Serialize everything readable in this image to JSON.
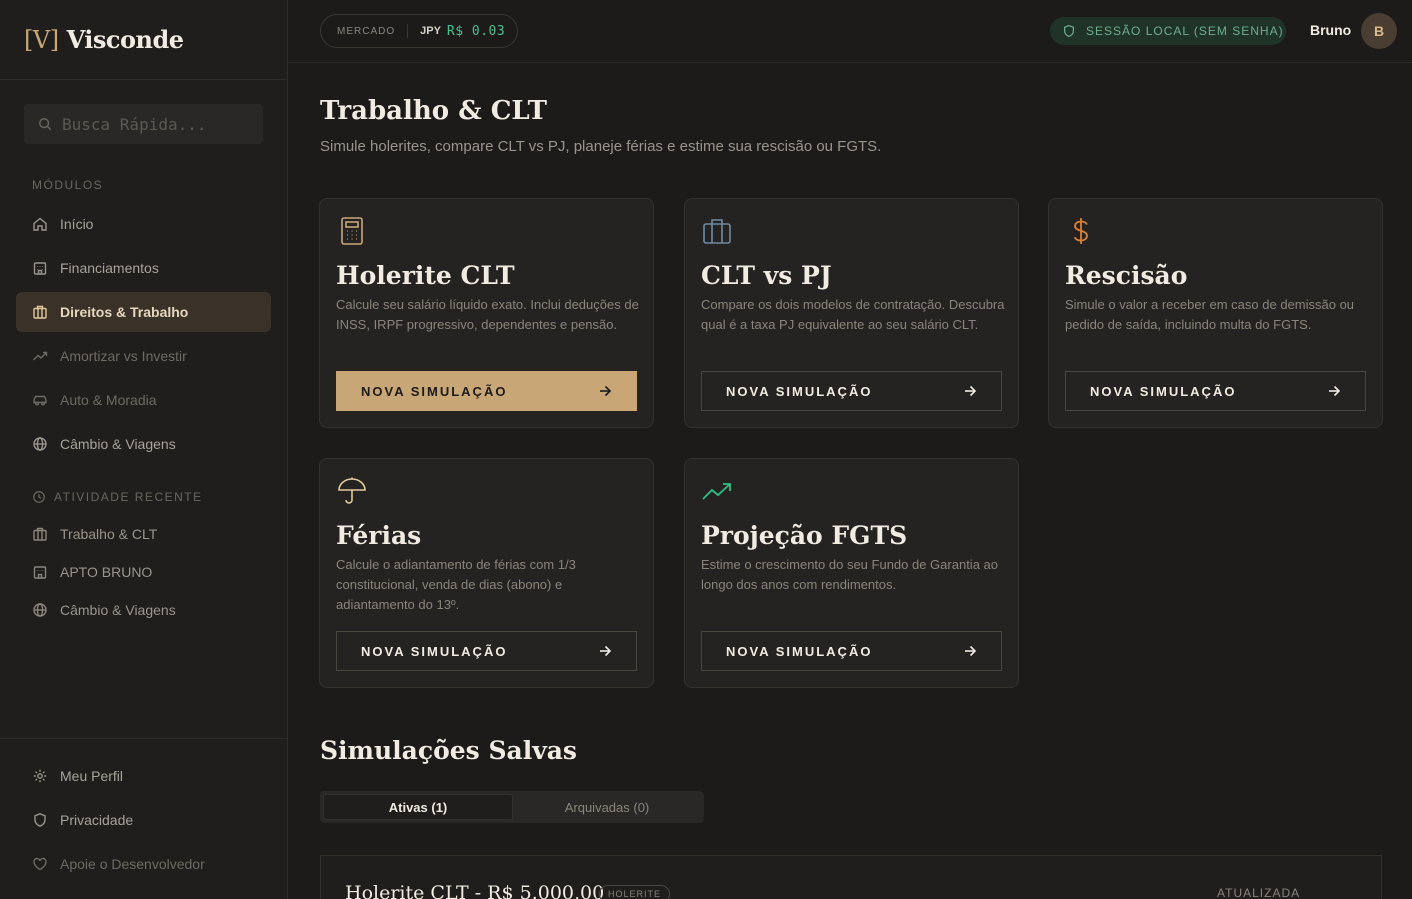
{
  "brand": {
    "bracket": "[V]",
    "name": "Visconde"
  },
  "search": {
    "placeholder": "Busca Rápida..."
  },
  "sidebar": {
    "modules_label": "MÓDULOS",
    "items": [
      {
        "label": "Início",
        "icon": "home-icon"
      },
      {
        "label": "Financiamentos",
        "icon": "building-icon"
      },
      {
        "label": "Direitos & Trabalho",
        "icon": "briefcase-icon",
        "active": true
      },
      {
        "label": "Amortizar vs Investir",
        "icon": "trend-icon"
      },
      {
        "label": "Auto & Moradia",
        "icon": "car-icon"
      },
      {
        "label": "Câmbio & Viagens",
        "icon": "globe-icon"
      }
    ],
    "recent_label": "ATIVIDADE RECENTE",
    "recent": [
      {
        "label": "Trabalho & CLT",
        "icon": "briefcase-icon"
      },
      {
        "label": "APTO BRUNO",
        "icon": "building-icon"
      },
      {
        "label": "Câmbio & Viagens",
        "icon": "globe-icon"
      }
    ],
    "bottom": [
      {
        "label": "Meu Perfil",
        "icon": "gear-icon"
      },
      {
        "label": "Privacidade",
        "icon": "shield-icon"
      },
      {
        "label": "Apoie o Desenvolvedor",
        "icon": "heart-icon"
      }
    ]
  },
  "topbar": {
    "market_label": "MERCADO",
    "currency": "JPY",
    "rate": "R$ 0.03",
    "session": "SESSÃO LOCAL (SEM SENHA)",
    "user": "Bruno",
    "avatar_initial": "B"
  },
  "main": {
    "title": "Trabalho & CLT",
    "subtitle": "Simule holerites, compare CLT vs PJ, planeje férias e estime sua rescisão ou FGTS.",
    "cards": [
      {
        "title": "Holerite CLT",
        "description": "Calcule seu salário líquido exato. Inclui deduções de INSS, IRPF progressivo, dependentes e pensão.",
        "button": "NOVA SIMULAÇÃO",
        "icon": "calculator-icon"
      },
      {
        "title": "CLT vs PJ",
        "description": "Compare os dois modelos de contratação. Descubra qual é a taxa PJ equivalente ao seu salário CLT.",
        "button": "NOVA SIMULAÇÃO",
        "icon": "briefcase-icon"
      },
      {
        "title": "Rescisão",
        "description": "Simule o valor a receber em caso de demissão ou pedido de saída, incluindo multa do FGTS.",
        "button": "NOVA SIMULAÇÃO",
        "icon": "dollar-icon"
      },
      {
        "title": "Férias",
        "description": "Calcule o adiantamento de férias com 1/3 constitucional, venda de dias (abono) e adiantamento do 13º.",
        "button": "NOVA SIMULAÇÃO",
        "icon": "umbrella-icon"
      },
      {
        "title": "Projeção FGTS",
        "description": "Estime o crescimento do seu Fundo de Garantia ao longo dos anos com rendimentos.",
        "button": "NOVA SIMULAÇÃO",
        "icon": "trending-up-icon"
      }
    ],
    "saved_title": "Simulações Salvas",
    "tabs": [
      "Ativas (1)",
      "Arquivadas (0)"
    ],
    "saved": [
      {
        "title": "Holerite CLT - R$ 5.000,00",
        "badge": "HOLERITE",
        "status": "ATUALIZADA"
      }
    ]
  },
  "colors": {
    "accent": "#c8a676",
    "green": "#4fbf8f",
    "background": "#1c1b1a"
  }
}
